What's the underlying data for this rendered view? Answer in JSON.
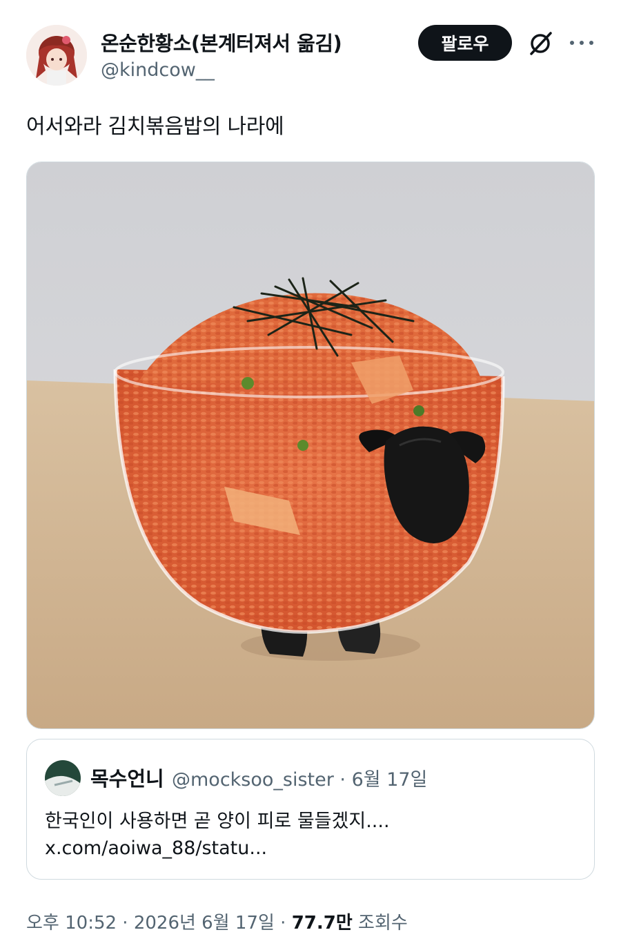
{
  "author": {
    "display_name": "온순한황소(본계터져서 옮김)",
    "handle": "@kindcow__"
  },
  "follow_label": "팔로우",
  "tweet_text": "어서와라 김치볶음밥의 나라에",
  "quoted": {
    "display_name": "목수언니",
    "handle_date": "@mocksoo_sister · 6월 17일",
    "text": "한국인이 사용하면 곧 양이 피로 물들겠지....",
    "link": "x.com/aoiwa_88/statu..."
  },
  "meta": {
    "time_date": "오후 10:52 · 2026년 6월 17일 · ",
    "views_count": "77.7만",
    "views_label": " 조회수"
  },
  "icons": [
    "grok-icon",
    "more-icon"
  ]
}
